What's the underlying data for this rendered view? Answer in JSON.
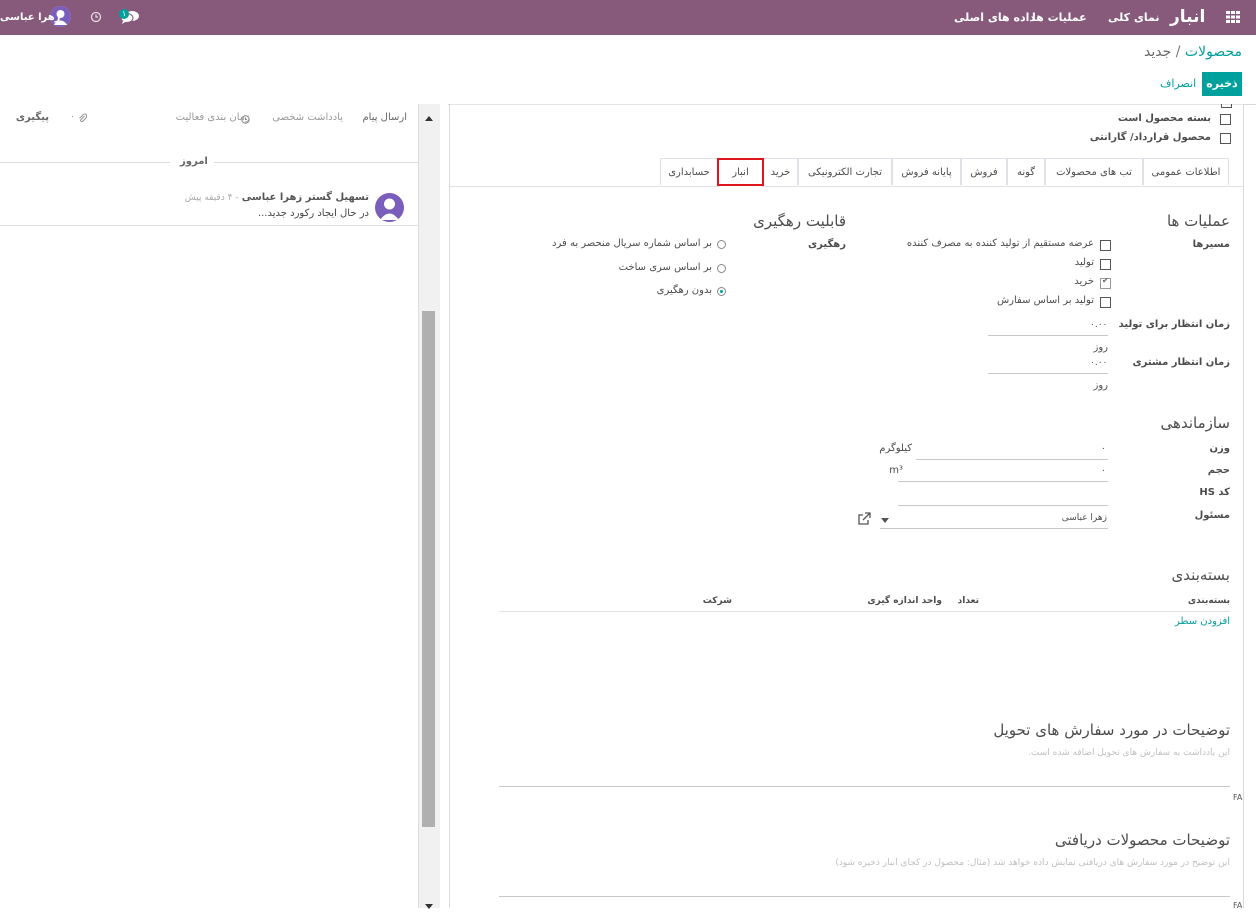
{
  "nav": {
    "app_title": "انبار",
    "menus": [
      "نمای کلی",
      "عملیات ها",
      "داده های اصلی"
    ],
    "user_name": "زهرا عباسی",
    "message_count": "۱"
  },
  "control_panel": {
    "breadcrumb_root": "محصولات",
    "breadcrumb_sep": "/",
    "breadcrumb_current": "جدید",
    "save_label": "ذخیره",
    "discard_label": "انصراف"
  },
  "form": {
    "checkbox_bundle": "بسته محصول است",
    "checkbox_contract": "محصول قرارداد/ گارانتی",
    "tabs": [
      {
        "label": "اطلاعات عمومی"
      },
      {
        "label": "تب های محصولات"
      },
      {
        "label": "گونه"
      },
      {
        "label": "فروش"
      },
      {
        "label": "پایانه فروش"
      },
      {
        "label": "تجارت الکترونیکی"
      },
      {
        "label": "خرید"
      },
      {
        "label": "انبار"
      },
      {
        "label": "حسابداری"
      }
    ],
    "operations_title": "عملیات ها",
    "routes_label": "مسیرها",
    "routes": [
      {
        "label": "عرضه مستقیم از تولید کننده به مصرف کننده",
        "checked": false
      },
      {
        "label": "تولید",
        "checked": false
      },
      {
        "label": "خرید",
        "checked": true
      },
      {
        "label": "تولید بر اساس سفارش",
        "checked": false
      }
    ],
    "manufacture_lead_label": "زمان انتظار برای تولید",
    "manufacture_lead_value": "۰.۰۰",
    "manufacture_lead_unit": "روز",
    "customer_lead_label": "زمان انتظار مشتری",
    "customer_lead_value": "۰.۰۰",
    "customer_lead_unit": "روز",
    "traceability_title": "قابلیت رهگیری",
    "tracking_label": "رهگیری",
    "tracking_options": [
      {
        "label": "بر اساس شماره سریال منحصر به فرد",
        "selected": false
      },
      {
        "label": "بر اساس سری ساخت",
        "selected": false
      },
      {
        "label": "بدون رهگیری",
        "selected": true
      }
    ],
    "organization_title": "سازماندهی",
    "weight_label": "وزن",
    "weight_value": "۰",
    "weight_unit": "کیلوگرم",
    "volume_label": "حجم",
    "volume_value": "۰",
    "volume_unit": "m³",
    "hs_code_label": "کد HS",
    "responsible_label": "مسئول",
    "responsible_value": "زهرا عباسی",
    "packaging_title": "بسته‌بندی",
    "packaging_columns": [
      "بسته‌بندی",
      "تعداد",
      "واحد اندازه گیری",
      "شرکت"
    ],
    "add_line": "افزودن سطر",
    "delivery_notes_title": "توضیحات در مورد سفارش های تحویل",
    "delivery_notes_placeholder": "این یادداشت به سفارش های تحویل اضافه شده است.",
    "receipt_notes_title": "توضیحات محصولات دریافتی",
    "receipt_notes_placeholder": "این توضیح در مورد سفارش های دریافتی نمایش داده خواهد شد (مثال: محصول در کجای انبار ذخیره شود)",
    "lang_badge": "FA"
  },
  "chatter": {
    "send_message": "ارسال پیام",
    "log_note": "یادداشت شخصی",
    "schedule_activity": "زمان بندی فعالیت",
    "attachments_count": "۰",
    "follow": "پیگیری",
    "today": "امروز",
    "author": "تسهیل گستر زهرا عباسی",
    "time_ago": "- ۴ دقیقه پیش",
    "message": "در حال ایجاد رکورد جدید..."
  },
  "colors": {
    "brand": "#875a7b",
    "accent": "#00a09d",
    "highlight": "#e0161c"
  }
}
